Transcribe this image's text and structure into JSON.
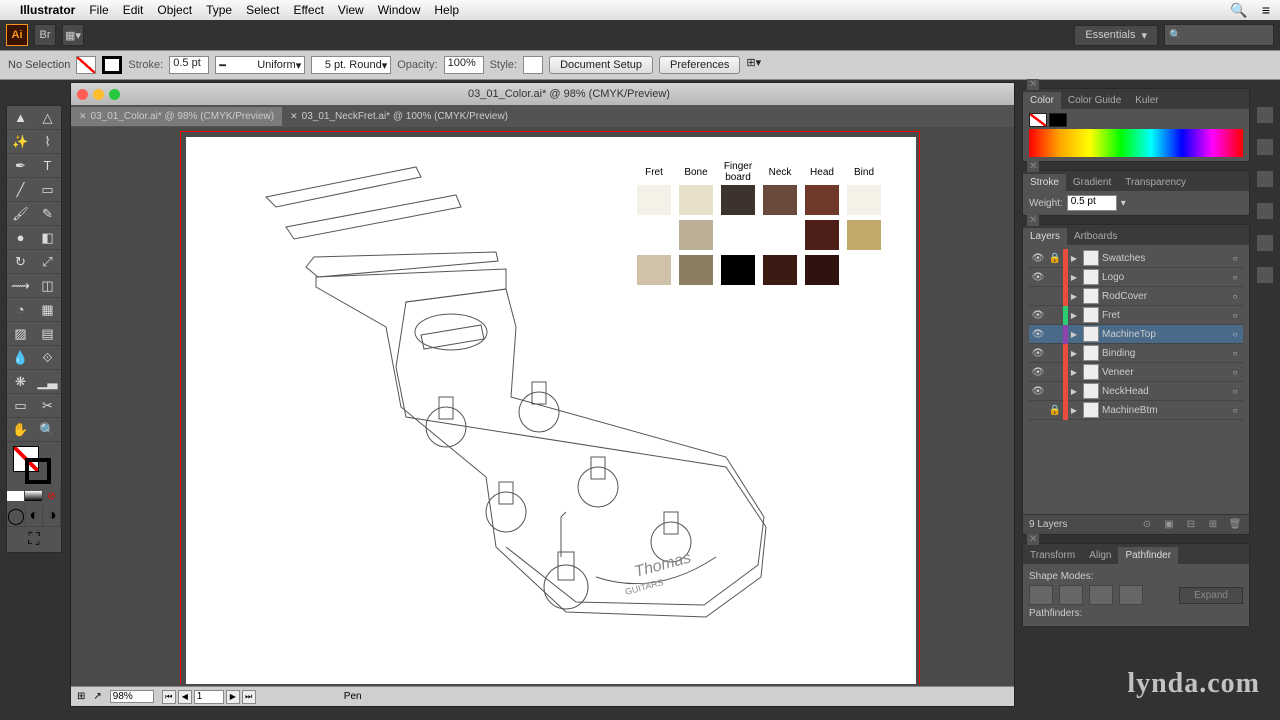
{
  "menubar": {
    "app": "Illustrator",
    "items": [
      "File",
      "Edit",
      "Object",
      "Type",
      "Select",
      "Effect",
      "View",
      "Window",
      "Help"
    ]
  },
  "appbar": {
    "workspace": "Essentials"
  },
  "control": {
    "selection": "No Selection",
    "stroke_label": "Stroke:",
    "stroke_weight": "0.5 pt",
    "stroke_style": "Uniform",
    "brush": "5 pt. Round",
    "opacity_label": "Opacity:",
    "opacity": "100%",
    "style_label": "Style:",
    "doc_setup": "Document Setup",
    "prefs": "Preferences"
  },
  "doc": {
    "title": "03_01_Color.ai* @ 98% (CMYK/Preview)",
    "tabs": [
      {
        "label": "03_01_Color.ai* @ 98% (CMYK/Preview)",
        "active": true
      },
      {
        "label": "03_01_NeckFret.ai* @ 100% (CMYK/Preview)",
        "active": false
      }
    ],
    "status": {
      "zoom": "98%",
      "artboard": "1",
      "tool": "Pen"
    }
  },
  "legend": {
    "headers": [
      "Fret",
      "Bone",
      "Finger board",
      "Neck",
      "Head",
      "Bind"
    ],
    "rows": [
      [
        "#f4f2e6",
        "#e8e0c8",
        "#3e322c",
        "#6b4a3e",
        "#6f3a2c",
        "#f4f2e6"
      ],
      [
        "",
        "#bbae97",
        "",
        "",
        "#4e1f18",
        "#c2a96a"
      ],
      [
        "#cfc2a8",
        "#8c7f5f",
        "#000000",
        "#3a1a12",
        "#2e130e",
        ""
      ]
    ]
  },
  "panels": {
    "color": {
      "tabs": [
        "Color",
        "Color Guide",
        "Kuler"
      ],
      "active": 0
    },
    "stroke": {
      "tabs": [
        "Stroke",
        "Gradient",
        "Transparency"
      ],
      "active": 0,
      "weight_label": "Weight:",
      "weight": "0.5 pt"
    },
    "layers": {
      "tabs": [
        "Layers",
        "Artboards"
      ],
      "active": 0,
      "items": [
        {
          "name": "Swatches",
          "color": "#e74c3c",
          "vis": true,
          "lock": true
        },
        {
          "name": "Logo",
          "color": "#e74c3c",
          "vis": true,
          "lock": false
        },
        {
          "name": "RodCover",
          "color": "#e74c3c",
          "vis": false,
          "lock": false
        },
        {
          "name": "Fret",
          "color": "#2ecc71",
          "vis": true,
          "lock": false
        },
        {
          "name": "MachineTop",
          "color": "#8e44ad",
          "vis": true,
          "lock": false,
          "selected": true
        },
        {
          "name": "Binding",
          "color": "#e74c3c",
          "vis": true,
          "lock": false
        },
        {
          "name": "Veneer",
          "color": "#e74c3c",
          "vis": true,
          "lock": false
        },
        {
          "name": "NeckHead",
          "color": "#e74c3c",
          "vis": true,
          "lock": false
        },
        {
          "name": "MachineBtm",
          "color": "#e74c3c",
          "vis": false,
          "lock": true
        }
      ],
      "count": "9 Layers"
    },
    "pathfinder": {
      "tabs": [
        "Transform",
        "Align",
        "Pathfinder"
      ],
      "active": 2,
      "shape_modes": "Shape Modes:",
      "pathfinders": "Pathfinders:",
      "expand": "Expand"
    }
  },
  "watermark": "lynda.com"
}
